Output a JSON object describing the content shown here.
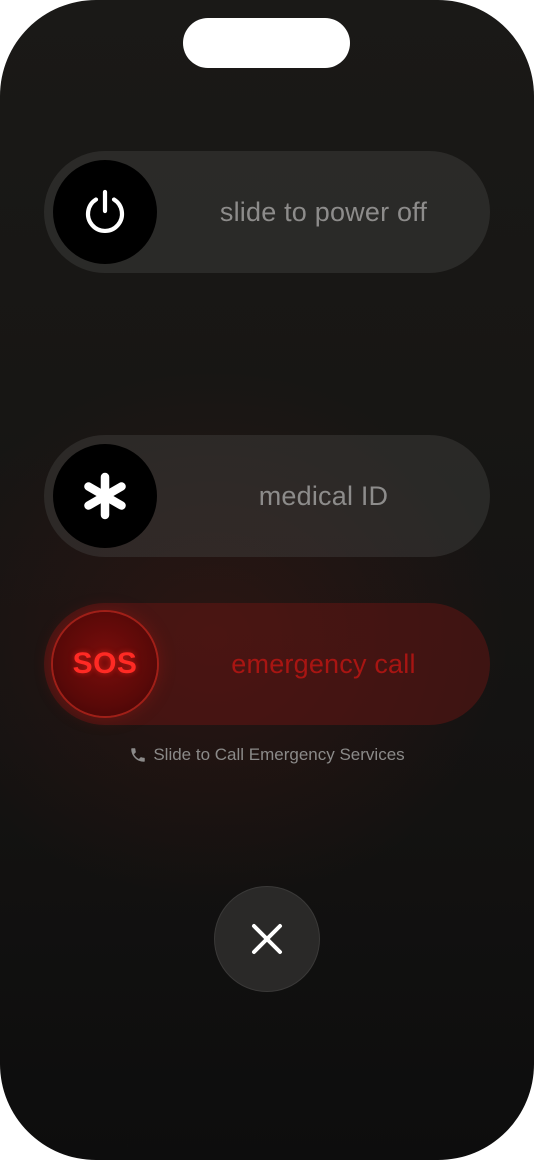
{
  "power_slider": {
    "label": "slide to power off",
    "icon": "power-icon"
  },
  "medical_slider": {
    "label": "medical ID",
    "icon": "asterisk-icon"
  },
  "sos_slider": {
    "knob_text": "SOS",
    "label": "emergency call",
    "accent_color": "#ff2a24"
  },
  "hint": {
    "icon": "phone-icon",
    "text": "Slide to Call Emergency Services"
  },
  "cancel": {
    "icon": "close-icon"
  }
}
